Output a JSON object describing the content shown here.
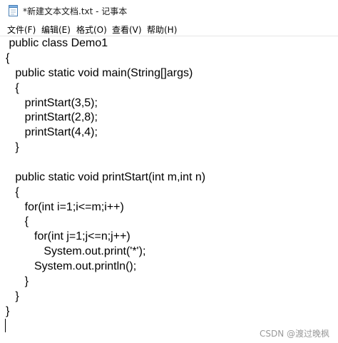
{
  "window": {
    "title": "*新建文本文档.txt - 记事本",
    "icon": "notepad-icon"
  },
  "menu": {
    "items": [
      "文件(F)",
      "编辑(E)",
      "格式(O)",
      "查看(V)",
      "帮助(H)"
    ]
  },
  "editor": {
    "lines": [
      " public class Demo1",
      "{",
      "   public static void main(String[]args)",
      "   {",
      "      printStart(3,5);",
      "      printStart(2,8);",
      "      printStart(4,4);",
      "   }",
      "",
      "   public static void printStart(int m,int n)",
      "   {",
      "      for(int i=1;i<=m;i++)",
      "      {",
      "         for(int j=1;j<=n;j++)",
      "            System.out.print('*');",
      "         System.out.println();",
      "      }",
      "   }",
      "}"
    ]
  },
  "watermark": "CSDN @渡过晚枫"
}
